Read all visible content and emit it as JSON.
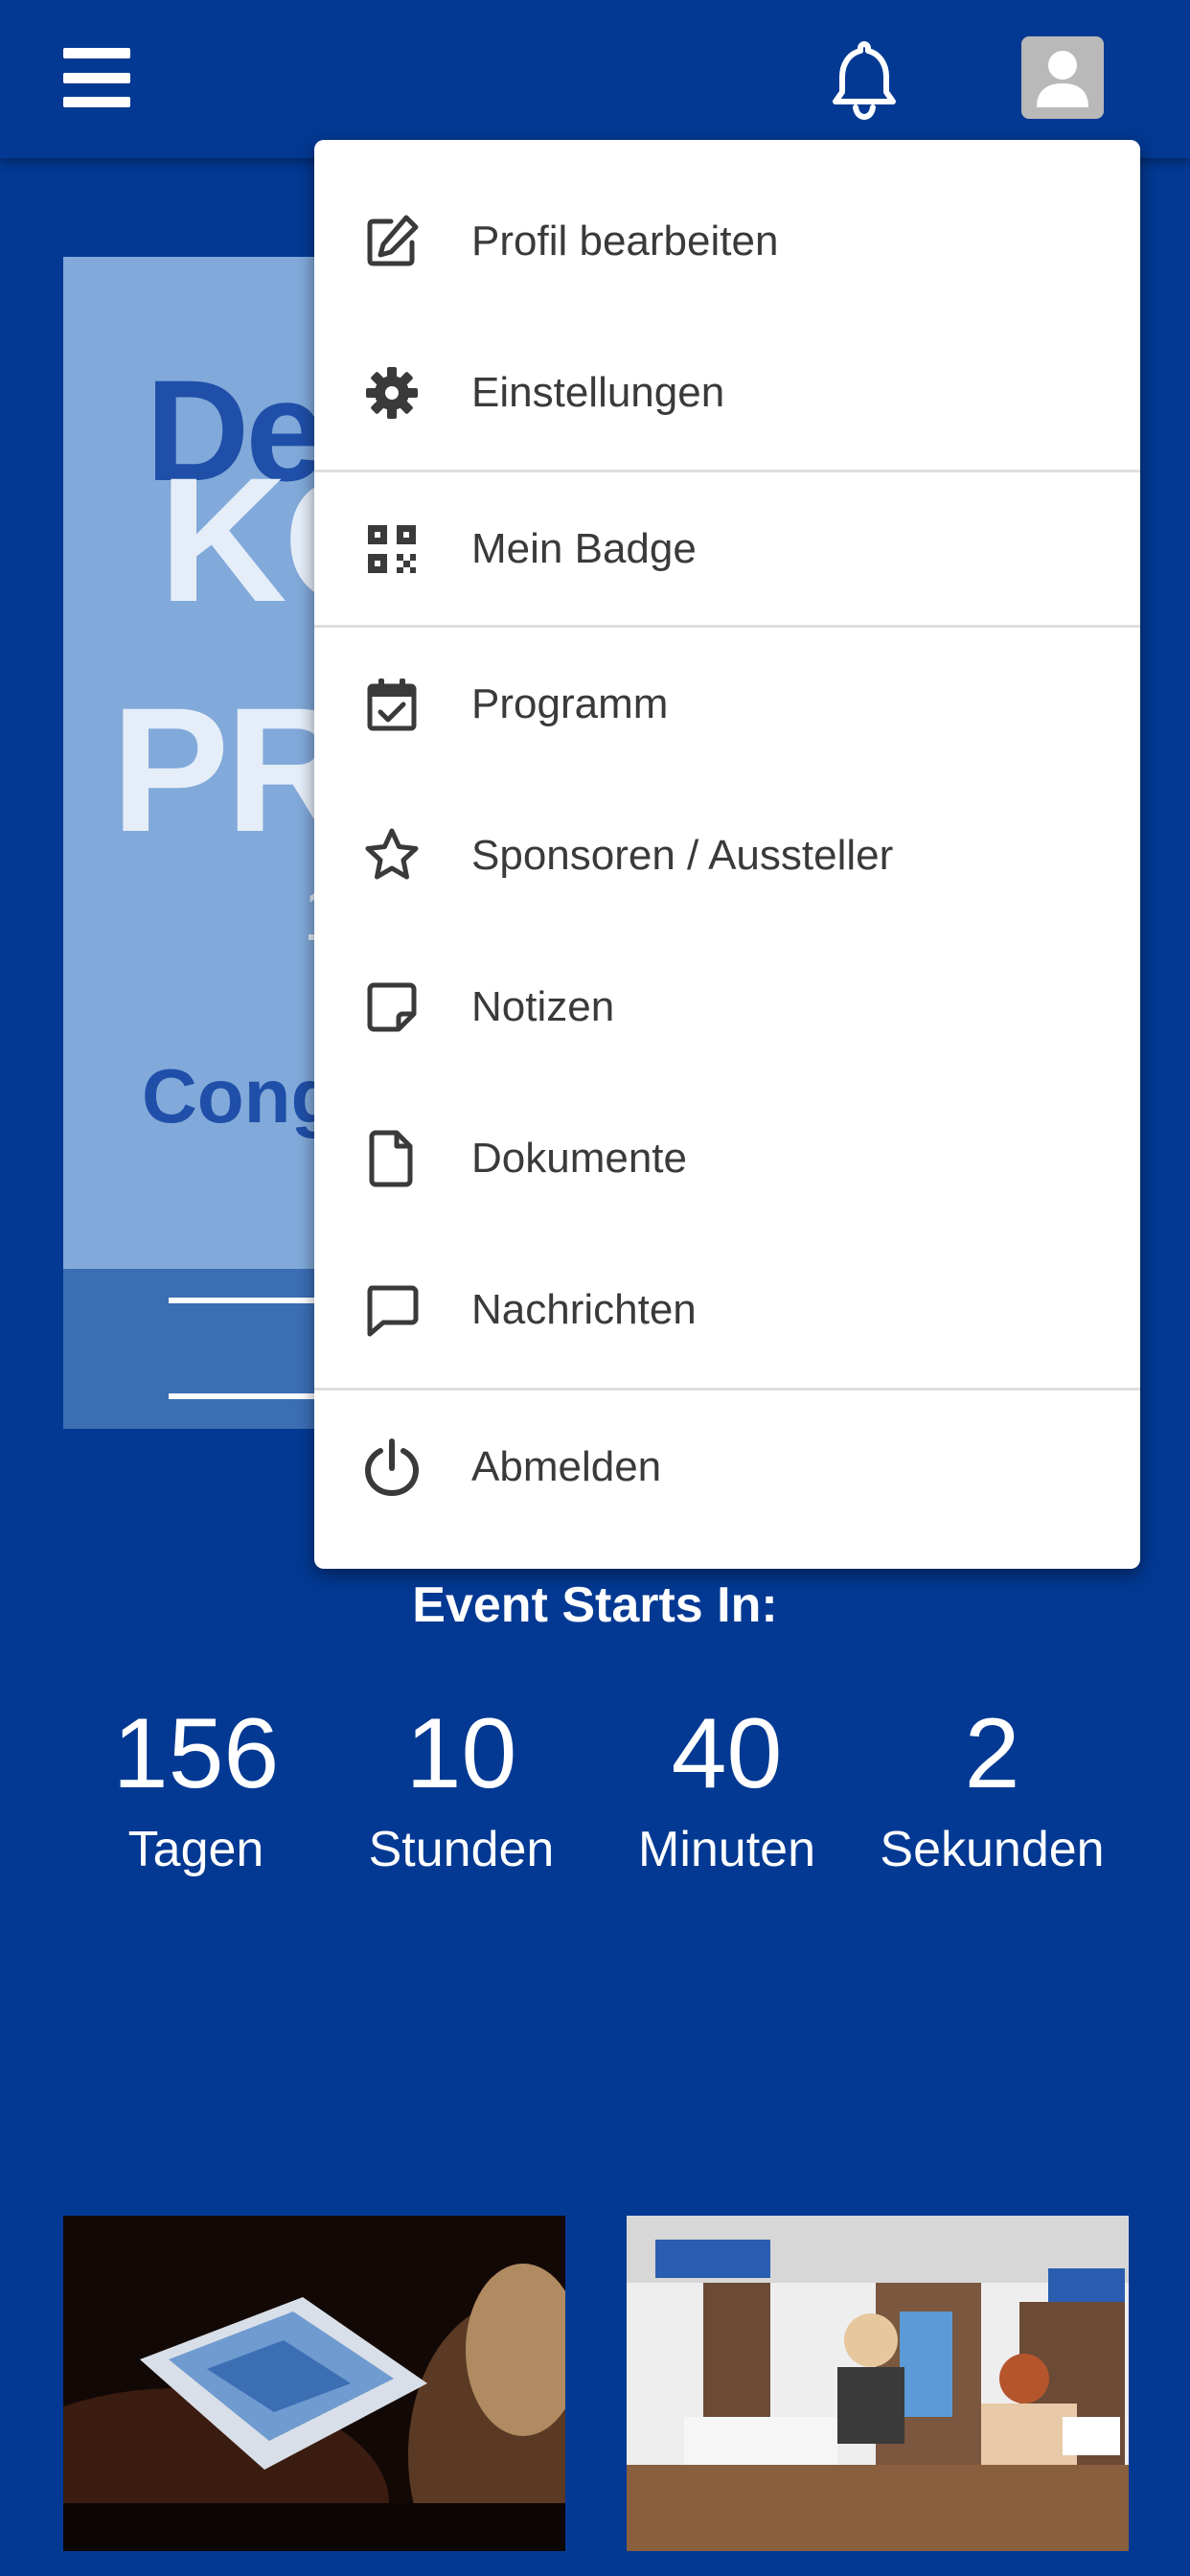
{
  "header": {
    "menu_icon": "hamburger-menu-icon",
    "notification_icon": "bell-icon",
    "profile_icon": "user-avatar-icon"
  },
  "hero": {
    "line1": "De",
    "line2": "KO",
    "line3": "PR",
    "line4": "1",
    "line5": "Cong"
  },
  "menu": {
    "items": [
      {
        "label": "Profil bearbeiten",
        "icon": "edit-icon"
      },
      {
        "label": "Einstellungen",
        "icon": "gear-icon"
      },
      {
        "label": "Mein Badge",
        "icon": "qr-code-icon"
      },
      {
        "label": "Programm",
        "icon": "calendar-check-icon"
      },
      {
        "label": "Sponsoren / Aussteller",
        "icon": "star-icon"
      },
      {
        "label": "Notizen",
        "icon": "sticky-note-icon"
      },
      {
        "label": "Dokumente",
        "icon": "document-icon"
      },
      {
        "label": "Nachrichten",
        "icon": "chat-icon"
      },
      {
        "label": "Abmelden",
        "icon": "power-icon"
      }
    ]
  },
  "countdown": {
    "title": "Event Starts In:",
    "units": [
      {
        "value": "156",
        "label": "Tagen"
      },
      {
        "value": "10",
        "label": "Stunden"
      },
      {
        "value": "40",
        "label": "Minuten"
      },
      {
        "value": "2",
        "label": "Sekunden"
      }
    ]
  },
  "colors": {
    "background": "#033993",
    "hero": "#81a9da",
    "menu_text": "#3a3a3a"
  }
}
